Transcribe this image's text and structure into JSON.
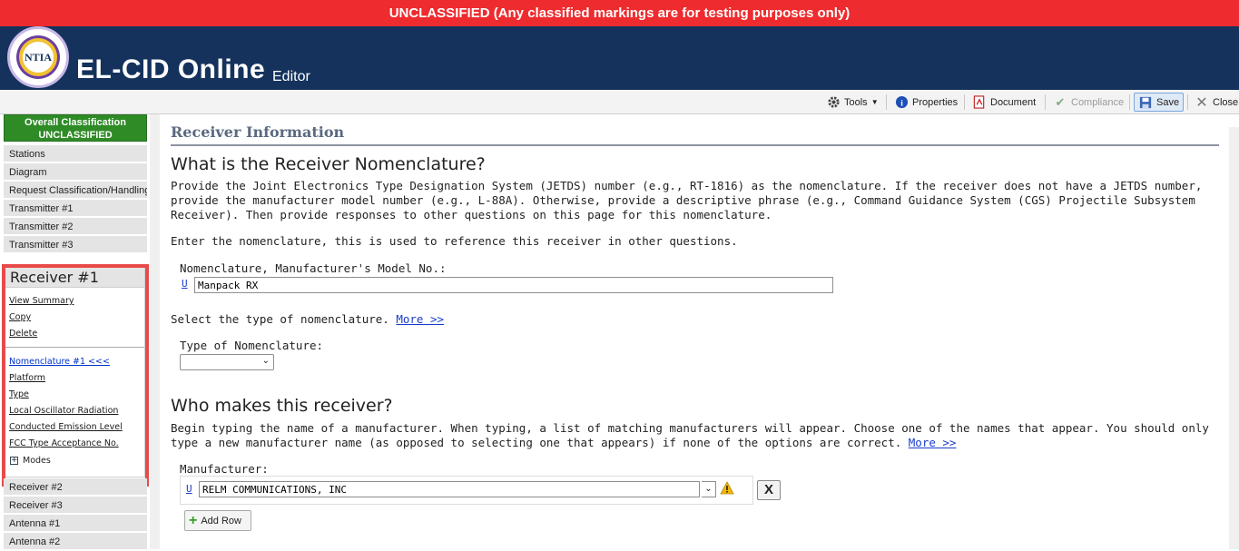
{
  "banner": "UNCLASSIFIED (Any classified markings are for testing purposes only)",
  "header": {
    "logo_text": "NTIA",
    "title": "EL-CID Online",
    "subtitle": "Editor"
  },
  "toolbar": {
    "tools": "Tools",
    "properties": "Properties",
    "document": "Document",
    "compliance": "Compliance",
    "save": "Save",
    "close": "Close"
  },
  "sidebar": {
    "classification_line1": "Overall Classification",
    "classification_line2": "UNCLASSIFIED",
    "items_top": [
      "Stations",
      "Diagram",
      "Request Classification/Handling",
      "Transmitter #1",
      "Transmitter #2",
      "Transmitter #3"
    ],
    "receiver": {
      "title": "Receiver #1",
      "actions": [
        "View Summary",
        "Copy",
        "Delete"
      ],
      "sections": [
        "Nomenclature #1 <<<",
        "Platform",
        "Type",
        "Local Oscillator Radiation",
        "Conducted Emission Level",
        "FCC Type Acceptance No."
      ],
      "modes_label": "Modes"
    },
    "items_bottom": [
      "Receiver #2",
      "Receiver #3",
      "Antenna #1",
      "Antenna #2"
    ]
  },
  "main": {
    "section_title": "Receiver Information",
    "q1_title": "What is the Receiver Nomenclature?",
    "q1_para": "Provide the Joint Electronics Type Designation System (JETDS) number (e.g., RT-1816) as the nomenclature. If the receiver does not have a JETDS number, provide the manufacturer model number (e.g., L-88A). Otherwise, provide a descriptive phrase (e.g., Command Guidance System (CGS) Projectile Subsystem Receiver). Then provide responses to other questions on this page for this nomenclature.",
    "q1_enter": "Enter the nomenclature, this is used to reference this receiver in other questions.",
    "nomenclature_label": "Nomenclature, Manufacturer's Model No.:",
    "u_marker": "U",
    "nomenclature_value": "Manpack RX",
    "select_type_text": "Select the type of nomenclature.",
    "more": "More >>",
    "type_label": "Type of Nomenclature:",
    "type_value": "",
    "q2_title": "Who makes this receiver?",
    "q2_para": "Begin typing the name of a manufacturer. When typing, a list of matching manufacturers will appear. Choose one of the names that appear. You should only type a new manufacturer name (as opposed to selecting one that appears) if none of the options are correct.",
    "manufacturer_label": "Manufacturer:",
    "manufacturer_value": "RELM COMMUNICATIONS, INC",
    "remove_symbol": "X",
    "add_row": "Add Row"
  }
}
